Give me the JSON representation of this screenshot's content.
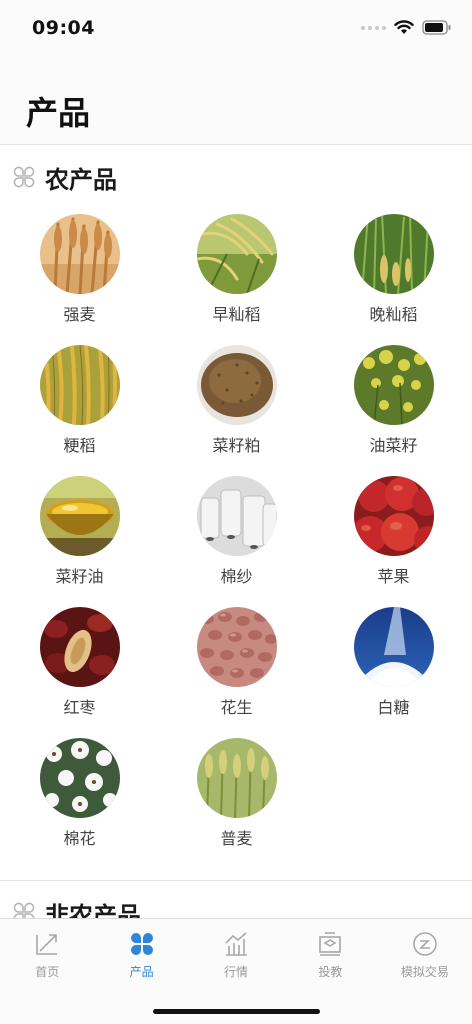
{
  "status_bar": {
    "time": "09:04"
  },
  "header": {
    "title": "产品"
  },
  "sections": [
    {
      "title": "农产品",
      "items": [
        {
          "label": "强麦"
        },
        {
          "label": "早籼稻"
        },
        {
          "label": "晚籼稻"
        },
        {
          "label": "粳稻"
        },
        {
          "label": "菜籽粕"
        },
        {
          "label": "油菜籽"
        },
        {
          "label": "菜籽油"
        },
        {
          "label": "棉纱"
        },
        {
          "label": "苹果"
        },
        {
          "label": "红枣"
        },
        {
          "label": "花生"
        },
        {
          "label": "白糖"
        },
        {
          "label": "棉花"
        },
        {
          "label": "普麦"
        }
      ]
    },
    {
      "title": "非农产品"
    }
  ],
  "tab_bar": {
    "tabs": [
      {
        "label": "首页",
        "icon": "home-chart-icon"
      },
      {
        "label": "产品",
        "icon": "clover-icon",
        "active": true
      },
      {
        "label": "行情",
        "icon": "trend-chart-icon"
      },
      {
        "label": "投教",
        "icon": "education-icon"
      },
      {
        "label": "模拟交易",
        "icon": "trade-icon"
      }
    ]
  },
  "colors": {
    "accent": "#2f86d6",
    "tab_inactive": "#9a9a9a",
    "text_dark": "#1a1a1a"
  }
}
